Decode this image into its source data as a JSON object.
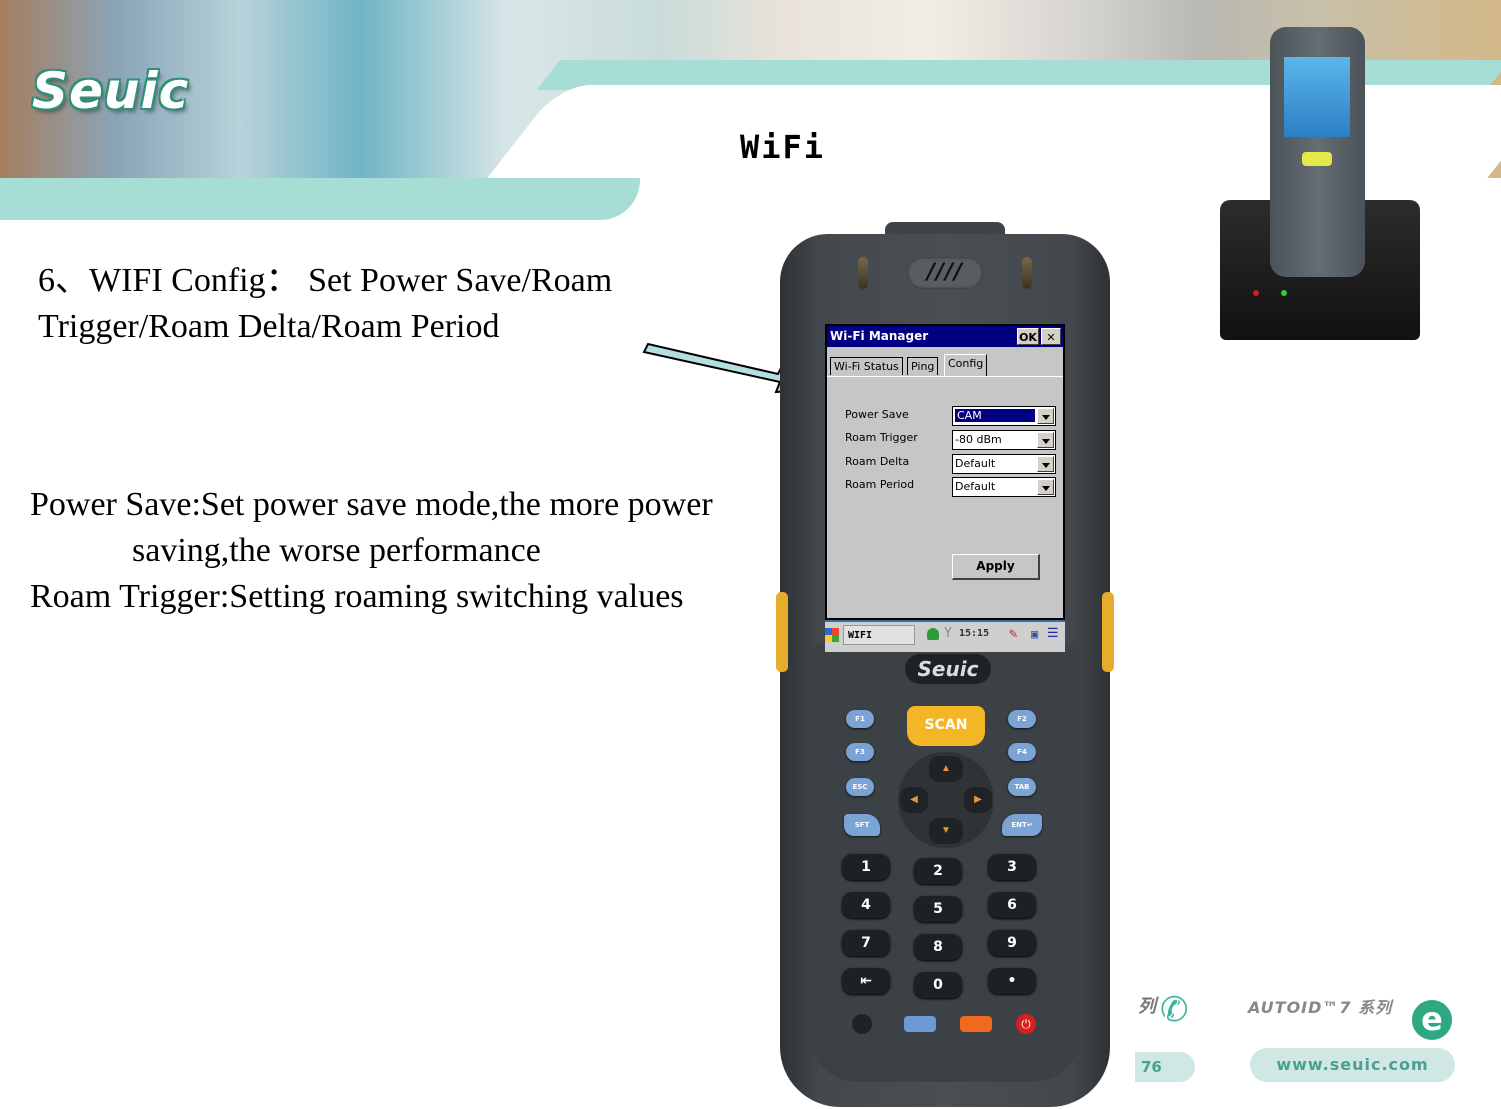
{
  "slide": {
    "title": "WiFi",
    "logo": "Seuic",
    "heading_line1": "6、WIFI Config： Set Power Save/Roam",
    "heading_line2": "Trigger/Roam Delta/Roam Period",
    "desc_line1": "Power Save:Set power save mode,the more power",
    "desc_line2": "saving,the worse performance",
    "desc_line3": "Roam Trigger:Setting roaming switching values"
  },
  "device": {
    "brand": "Seuic",
    "speaker_glyph": "////",
    "window": {
      "title": "Wi-Fi Manager",
      "ok_label": "OK",
      "close_label": "✕",
      "tabs": [
        {
          "label": "Wi-Fi Status",
          "active": false
        },
        {
          "label": "Ping",
          "active": false
        },
        {
          "label": "Config",
          "active": true
        }
      ],
      "fields": [
        {
          "label": "Power Save",
          "value": "CAM",
          "selected": true
        },
        {
          "label": "Roam Trigger",
          "value": "-80 dBm",
          "selected": false
        },
        {
          "label": "Roam Delta",
          "value": "Default",
          "selected": false
        },
        {
          "label": "Roam Period",
          "value": "Default",
          "selected": false
        }
      ],
      "apply_label": "Apply"
    },
    "taskbar": {
      "task_label": "WIFI",
      "clock": "15:15"
    },
    "keys": {
      "scan": "SCAN",
      "f1": "F1",
      "f2": "F2",
      "f3": "F3",
      "f4": "F4",
      "esc": "ESC",
      "tab": "TAB",
      "sft": "SFT",
      "ent": "ENT↵",
      "numbers": [
        "1",
        "2",
        "3",
        "4",
        "5",
        "6",
        "7",
        "8",
        "9",
        "⇤",
        "0",
        "•"
      ],
      "dpad_up": "▲",
      "dpad_down": "▼",
      "dpad_left": "◀",
      "dpad_right": "▶"
    }
  },
  "footer": {
    "phone_fragment": "76",
    "autoid_label": "AUTOID™7 系列",
    "website": "www.seuic.com",
    "ie_icon": "e"
  }
}
